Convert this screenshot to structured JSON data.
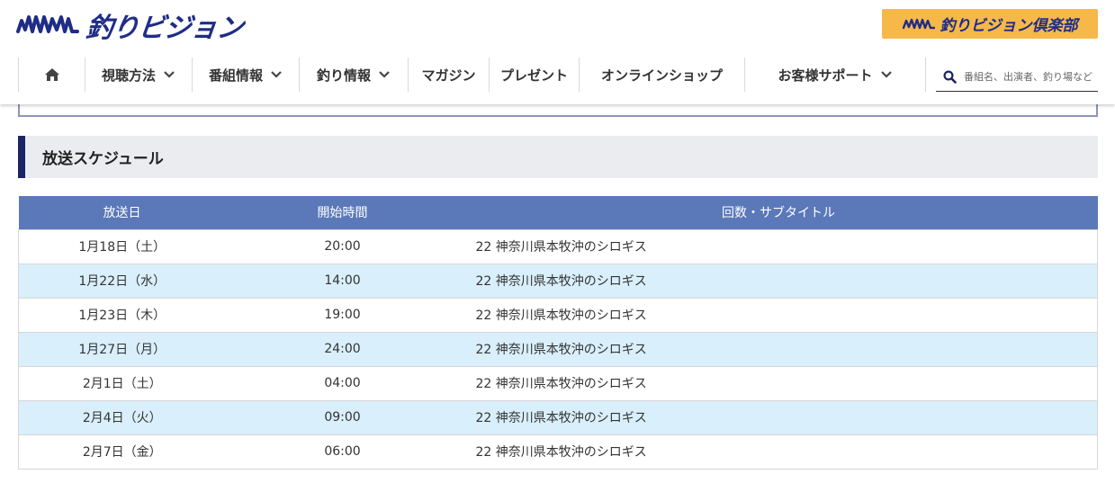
{
  "header": {
    "logo_text": "釣りビジョン",
    "club_button": "釣りビジョン倶楽部",
    "search_placeholder": "番組名、出演者、釣り場など",
    "brand_color": "#1f2d86",
    "club_color": "#f7b84a"
  },
  "nav": {
    "home_icon": "home-icon",
    "items": [
      {
        "label": "視聴方法",
        "dropdown": true
      },
      {
        "label": "番組情報",
        "dropdown": true
      },
      {
        "label": "釣り情報",
        "dropdown": true
      },
      {
        "label": "マガジン",
        "dropdown": false
      },
      {
        "label": "プレゼント",
        "dropdown": false
      },
      {
        "label": "オンラインショップ",
        "dropdown": false
      },
      {
        "label": "お客様サポート",
        "dropdown": true
      }
    ]
  },
  "section": {
    "title": "放送スケジュール",
    "accent_color": "#1b2466"
  },
  "schedule": {
    "header_color": "#5b78b9",
    "stripe_color": "#d9effb",
    "columns": [
      "放送日",
      "開始時間",
      "回数・サブタイトル"
    ],
    "rows": [
      {
        "date": "1月18日（土）",
        "time": "20:00",
        "title": "22 神奈川県本牧沖のシロギス"
      },
      {
        "date": "1月22日（水）",
        "time": "14:00",
        "title": "22 神奈川県本牧沖のシロギス"
      },
      {
        "date": "1月23日（木）",
        "time": "19:00",
        "title": "22 神奈川県本牧沖のシロギス"
      },
      {
        "date": "1月27日（月）",
        "time": "24:00",
        "title": "22 神奈川県本牧沖のシロギス"
      },
      {
        "date": "2月1日（土）",
        "time": "04:00",
        "title": "22 神奈川県本牧沖のシロギス"
      },
      {
        "date": "2月4日（火）",
        "time": "09:00",
        "title": "22 神奈川県本牧沖のシロギス"
      },
      {
        "date": "2月7日（金）",
        "time": "06:00",
        "title": "22 神奈川県本牧沖のシロギス"
      }
    ]
  }
}
